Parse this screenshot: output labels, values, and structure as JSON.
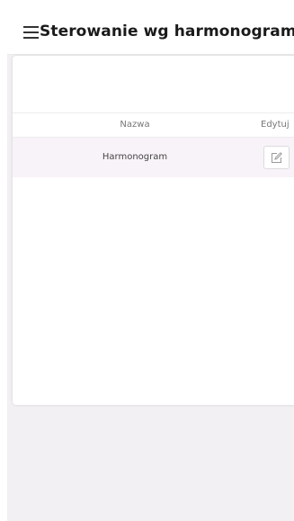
{
  "header": {
    "title": "Sterowanie wg harmonogramu",
    "menu_icon": "hamburger-menu-icon"
  },
  "table": {
    "columns": {
      "name": "Nazwa",
      "edit": "Edytuj"
    },
    "rows": [
      {
        "name": "Harmonogram",
        "edit_icon": "edit-icon"
      }
    ]
  },
  "colors": {
    "page_background": "#f2f0f2",
    "row_highlight": "#f8f3f8",
    "card_background": "#ffffff"
  }
}
